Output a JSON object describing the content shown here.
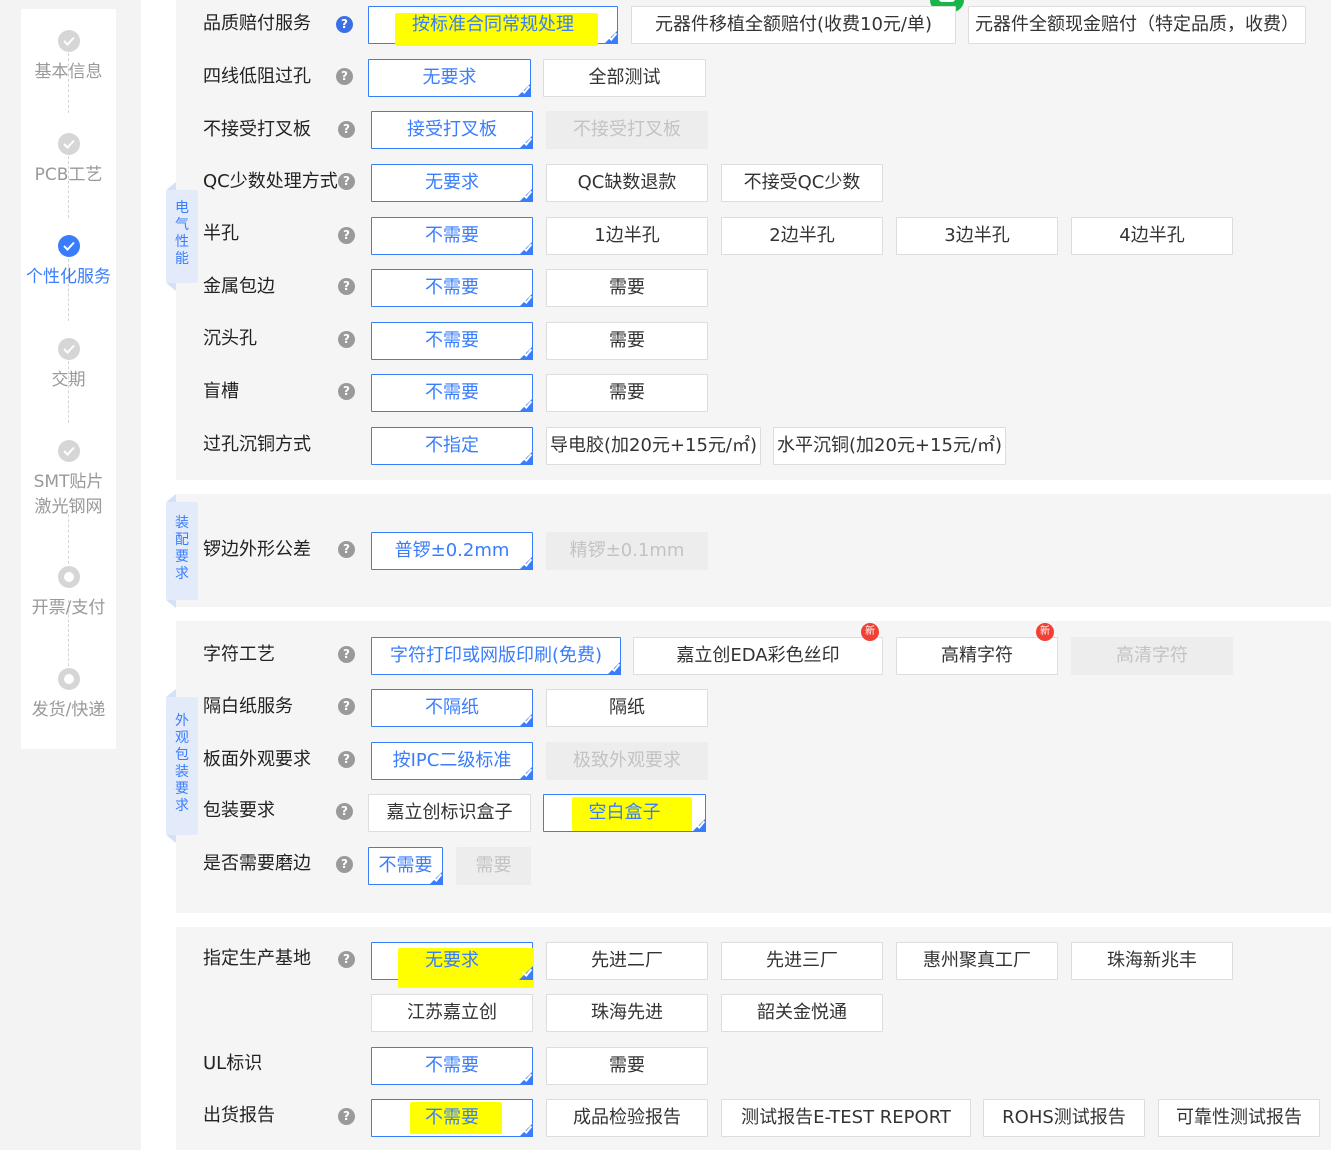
{
  "sidebar": {
    "steps": [
      {
        "label": "基本信息",
        "state": "done"
      },
      {
        "label": "PCB工艺",
        "state": "done"
      },
      {
        "label": "个性化服务",
        "state": "active"
      },
      {
        "label": "交期",
        "state": "done"
      },
      {
        "label": "SMT贴片\n激光钢网",
        "state": "done"
      },
      {
        "label": "开票/支付",
        "state": "pending"
      },
      {
        "label": "发货/快递",
        "state": "pending"
      }
    ]
  },
  "section_tags": {
    "electrical": "电气性能",
    "assembly": "装配要求",
    "appearance": "外观包装要求"
  },
  "new_badge": "新",
  "help_glyph": "?",
  "rows": {
    "quality_comp": {
      "label": "品质赔付服务",
      "options": [
        "按标准合同常规处理",
        "元器件移植全额赔付(收费10元/单)",
        "元器件全额现金赔付（特定品质，收费）"
      ],
      "selected": 0
    },
    "four_wire": {
      "label": "四线低阻过孔",
      "options": [
        "无要求",
        "全部测试"
      ],
      "selected": 0
    },
    "x_board": {
      "label": "不接受打叉板",
      "options": [
        "接受打叉板",
        "不接受打叉板"
      ],
      "selected": 0,
      "disabled": [
        1
      ]
    },
    "qc": {
      "label": "QC少数处理方式",
      "options": [
        "无要求",
        "QC缺数退款",
        "不接受QC少数"
      ],
      "selected": 0
    },
    "half_hole": {
      "label": "半孔",
      "options": [
        "不需要",
        "1边半孔",
        "2边半孔",
        "3边半孔",
        "4边半孔"
      ],
      "selected": 0
    },
    "metal_edge": {
      "label": "金属包边",
      "options": [
        "不需要",
        "需要"
      ],
      "selected": 0
    },
    "countersink": {
      "label": "沉头孔",
      "options": [
        "不需要",
        "需要"
      ],
      "selected": 0
    },
    "blind_slot": {
      "label": "盲槽",
      "options": [
        "不需要",
        "需要"
      ],
      "selected": 0
    },
    "via_copper": {
      "label": "过孔沉铜方式",
      "options": [
        "不指定",
        "导电胶(加20元+15元/㎡)",
        "水平沉铜(加20元+15元/㎡)"
      ],
      "selected": 0
    },
    "edge_tol": {
      "label": "锣边外形公差",
      "options": [
        "普锣±0.2mm",
        "精锣±0.1mm"
      ],
      "selected": 0,
      "disabled": [
        1
      ]
    },
    "char_process": {
      "label": "字符工艺",
      "options": [
        "字符打印或网版印刷(免费)",
        "嘉立创EDA彩色丝印",
        "高精字符",
        "高清字符"
      ],
      "selected": 0,
      "disabled": [
        3
      ]
    },
    "paper_sep": {
      "label": "隔白纸服务",
      "options": [
        "不隔纸",
        "隔纸"
      ],
      "selected": 0
    },
    "surface_req": {
      "label": "板面外观要求",
      "options": [
        "按IPC二级标准",
        "极致外观要求"
      ],
      "selected": 0,
      "disabled": [
        1
      ]
    },
    "packaging": {
      "label": "包装要求",
      "options": [
        "嘉立创标识盒子",
        "空白盒子"
      ],
      "selected": 1
    },
    "grinding": {
      "label": "是否需要磨边",
      "options": [
        "不需要",
        "需要"
      ],
      "selected": 0,
      "disabled": [
        1
      ]
    },
    "factory": {
      "label": "指定生产基地",
      "options": [
        "无要求",
        "先进二厂",
        "先进三厂",
        "惠州聚真工厂",
        "珠海新兆丰",
        "江苏嘉立创",
        "珠海先进",
        "韶关金悦通"
      ],
      "selected": 0
    },
    "ul_mark": {
      "label": "UL标识",
      "options": [
        "不需要",
        "需要"
      ],
      "selected": 0
    },
    "ship_report": {
      "label": "出货报告",
      "options": [
        "不需要",
        "成品检验报告",
        "测试报告E-TEST REPORT",
        "ROHS测试报告",
        "可靠性测试报告"
      ],
      "selected": 0
    }
  },
  "colors": {
    "accent": "#3a7dfc",
    "highlight": "#ffff00",
    "badge": "#f04134"
  }
}
